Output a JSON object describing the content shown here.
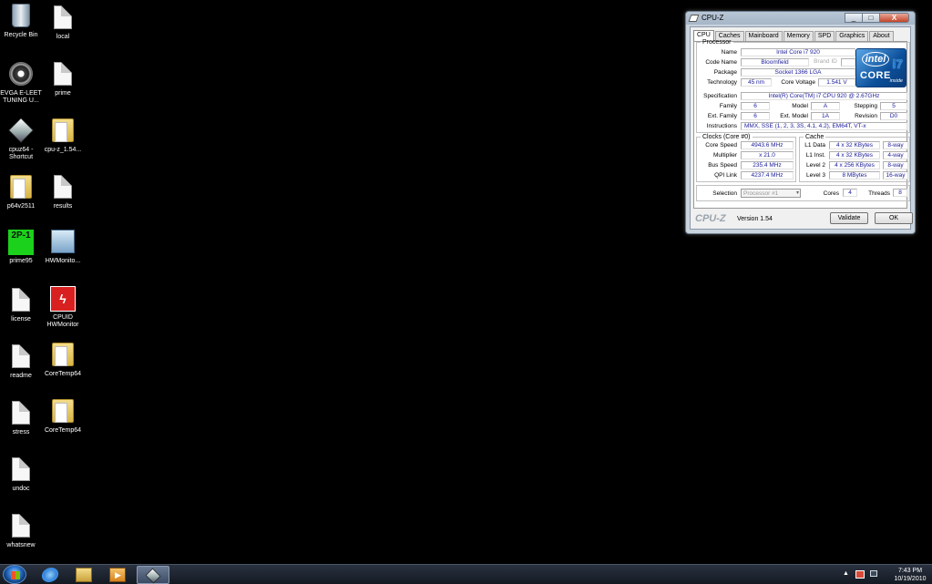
{
  "desktop": {
    "icons": [
      {
        "label": "Recycle Bin",
        "kind": "bin"
      },
      {
        "label": "local",
        "kind": "doc"
      },
      {
        "label": "EVGA E-LEET TUNING U...",
        "kind": "evga"
      },
      {
        "label": "prime",
        "kind": "doc"
      },
      {
        "label": "cpuz64 - Shortcut",
        "kind": "cpuz"
      },
      {
        "label": "cpu-z_1.54...",
        "kind": "folder"
      },
      {
        "label": "p64v2511",
        "kind": "folder"
      },
      {
        "label": "results",
        "kind": "doc"
      },
      {
        "label": "prime95",
        "kind": "prime95",
        "glyph": "2P-1"
      },
      {
        "label": "HWMonito...",
        "kind": "hwmon"
      },
      {
        "label": "license",
        "kind": "doc"
      },
      {
        "label": "CPUID HWMonitor",
        "kind": "cpuid"
      },
      {
        "label": "readme",
        "kind": "doc"
      },
      {
        "label": "CoreTemp64",
        "kind": "folder"
      },
      {
        "label": "stress",
        "kind": "doc"
      },
      {
        "label": "CoreTemp64",
        "kind": "folder"
      },
      {
        "label": "undoc",
        "kind": "doc"
      },
      {
        "label": "whatsnew",
        "kind": "doc"
      }
    ]
  },
  "window": {
    "title": "CPU-Z",
    "buttons": {
      "minimize": "_",
      "maximize": "□",
      "close": "X"
    },
    "tabs": [
      "CPU",
      "Caches",
      "Mainboard",
      "Memory",
      "SPD",
      "Graphics",
      "About"
    ],
    "active_tab": "CPU",
    "processor": {
      "group_label": "Processor",
      "name_label": "Name",
      "name": "Intel Core i7 920",
      "codename_label": "Code Name",
      "codename": "Bloomfield",
      "brand_id": "Brand ID",
      "package_label": "Package",
      "package": "Socket 1366 LGA",
      "technology_label": "Technology",
      "technology": "45 nm",
      "core_voltage_label": "Core Voltage",
      "core_voltage": "1.541 V",
      "specification_label": "Specification",
      "specification": "Intel(R) Core(TM) i7 CPU     920  @ 2.67GHz",
      "family_label": "Family",
      "family": "6",
      "model_label": "Model",
      "model": "A",
      "stepping_label": "Stepping",
      "stepping": "5",
      "ext_family_label": "Ext. Family",
      "ext_family": "6",
      "ext_model_label": "Ext. Model",
      "ext_model": "1A",
      "revision_label": "Revision",
      "revision": "D0",
      "instructions_label": "Instructions",
      "instructions": "MMX, SSE (1, 2, 3, 3S, 4.1, 4.2), EM64T, VT-x"
    },
    "intel_logo": {
      "brand": "intel",
      "line": "CORE",
      "model": "i7",
      "tag": "inside"
    },
    "clocks": {
      "group_label": "Clocks (Core #0)",
      "core_speed_label": "Core Speed",
      "core_speed": "4943.6 MHz",
      "multiplier_label": "Multiplier",
      "multiplier": "x 21.0",
      "bus_speed_label": "Bus Speed",
      "bus_speed": "235.4 MHz",
      "qpi_label": "QPI Link",
      "qpi": "4237.4 MHz"
    },
    "cache": {
      "group_label": "Cache",
      "rows": [
        {
          "label": "L1 Data",
          "size": "4 x 32 KBytes",
          "ways": "8-way"
        },
        {
          "label": "L1 Inst.",
          "size": "4 x 32 KBytes",
          "ways": "4-way"
        },
        {
          "label": "Level 2",
          "size": "4 x 256 KBytes",
          "ways": "8-way"
        },
        {
          "label": "Level 3",
          "size": "8 MBytes",
          "ways": "16-way"
        }
      ]
    },
    "selection": {
      "label": "Selection",
      "value": "Processor #1",
      "cores_label": "Cores",
      "cores": "4",
      "threads_label": "Threads",
      "threads": "8"
    },
    "footer": {
      "brand": "CPU-Z",
      "version": "Version 1.54",
      "validate": "Validate",
      "ok": "OK"
    }
  },
  "taskbar": {
    "time": "7:43 PM",
    "date": "10/19/2010",
    "tray_arrow": "▲"
  }
}
